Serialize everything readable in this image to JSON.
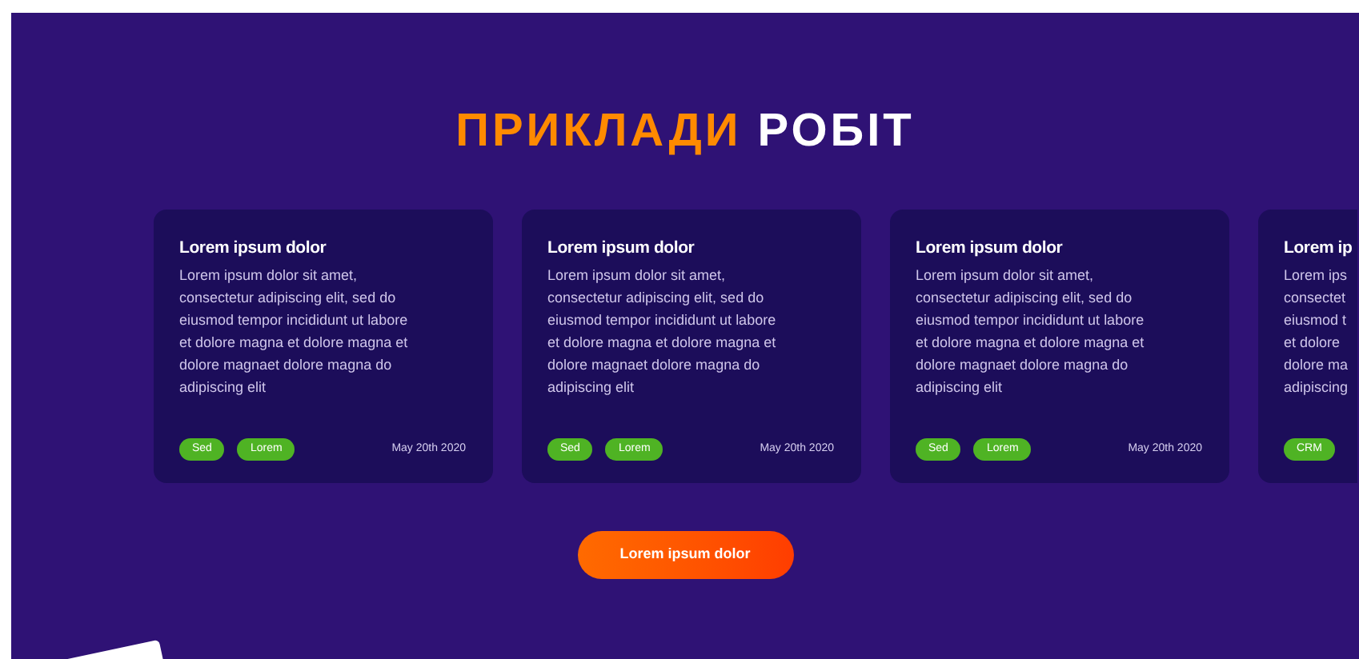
{
  "heading": {
    "accent": "ПРИКЛАДИ",
    "rest": "РОБІТ"
  },
  "cards": [
    {
      "kind": "full",
      "title": "Lorem ipsum dolor",
      "lines": [
        "Lorem ipsum dolor sit amet,",
        "consectetur adipiscing elit, sed do",
        "eiusmod tempor incididunt ut labore",
        "et dolore magna et dolore magna et",
        "dolore magnaet dolore magna do",
        "adipiscing elit"
      ],
      "tags": [
        "Sed",
        "Lorem"
      ],
      "date": "May 20th 2020"
    },
    {
      "kind": "full",
      "title": "Lorem ipsum dolor",
      "lines": [
        "Lorem ipsum dolor sit amet,",
        "consectetur adipiscing elit, sed do",
        "eiusmod tempor incididunt ut labore",
        "et dolore magna et dolore magna et",
        "dolore magnaet dolore magna do",
        "adipiscing elit"
      ],
      "tags": [
        "Sed",
        "Lorem"
      ],
      "date": "May 20th 2020"
    },
    {
      "kind": "full",
      "title": "Lorem ipsum dolor",
      "lines": [
        "Lorem ipsum dolor sit amet,",
        "consectetur adipiscing elit, sed do",
        "eiusmod tempor incididunt ut labore",
        "et dolore magna et dolore magna et",
        "dolore magnaet dolore magna do",
        "adipiscing elit"
      ],
      "tags": [
        "Sed",
        "Lorem"
      ],
      "date": "May 20th 2020"
    },
    {
      "kind": "cut",
      "title": "Lorem ip",
      "lines": [
        "Lorem ips",
        "consectet",
        "eiusmod t",
        "et dolore",
        "dolore ma",
        "adipiscing"
      ],
      "tags": [
        "CRM"
      ]
    }
  ],
  "button": "Lorem ipsum dolor"
}
